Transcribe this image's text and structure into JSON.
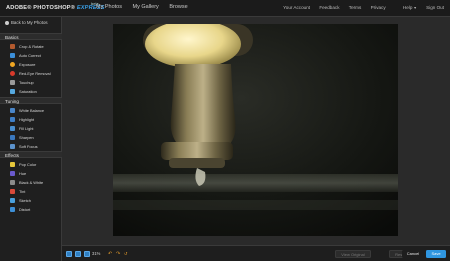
{
  "app": {
    "brand": "ADOBE® PHOTOSHOP®",
    "brand_suffix": "EXPRESS",
    "beta": "beta"
  },
  "topnav": [
    "My Photos",
    "My Gallery",
    "Browse"
  ],
  "toplinks": [
    "Your Account",
    "Feedback",
    "Terms",
    "Privacy",
    "Help",
    "Sign Out"
  ],
  "sidebar": {
    "back_label": "Back to My Photos",
    "sections": [
      {
        "title": "Basics",
        "items": [
          {
            "label": "Crop & Rotate",
            "icon": "crop-icon",
            "color": "#b35a2e"
          },
          {
            "label": "Auto Correct",
            "icon": "auto-correct-icon",
            "color": "#3b8fd9"
          },
          {
            "label": "Exposure",
            "icon": "exposure-icon",
            "color": "#f0a623"
          },
          {
            "label": "Red-Eye Removal",
            "icon": "red-eye-icon",
            "color": "#d93a2b"
          },
          {
            "label": "Touchup",
            "icon": "touchup-icon",
            "color": "#9a9a9a"
          },
          {
            "label": "Saturation",
            "icon": "saturation-icon",
            "color": "#56a9e0"
          }
        ]
      },
      {
        "title": "Tuning",
        "items": [
          {
            "label": "White Balance",
            "icon": "white-balance-icon",
            "color": "#4a86c9"
          },
          {
            "label": "Highlight",
            "icon": "highlight-icon",
            "color": "#3f7fc7"
          },
          {
            "label": "Fill Light",
            "icon": "fill-light-icon",
            "color": "#4a8fd0"
          },
          {
            "label": "Sharpen",
            "icon": "sharpen-icon",
            "color": "#3a78bf"
          },
          {
            "label": "Soft Focus",
            "icon": "soft-focus-icon",
            "color": "#5b92cc"
          }
        ]
      },
      {
        "title": "Effects",
        "items": [
          {
            "label": "Pop Color",
            "icon": "pop-color-icon",
            "color": "#e6c73b"
          },
          {
            "label": "Hue",
            "icon": "hue-icon",
            "color": "#6a5acd"
          },
          {
            "label": "Black & White",
            "icon": "black-white-icon",
            "color": "#8b8b8b"
          },
          {
            "label": "Tint",
            "icon": "tint-icon",
            "color": "#d94a3a"
          },
          {
            "label": "Sketch",
            "icon": "sketch-icon",
            "color": "#4aa0dd"
          },
          {
            "label": "Distort",
            "icon": "distort-icon",
            "color": "#3d8fd6"
          }
        ]
      }
    ]
  },
  "toolbar": {
    "zoom": "31%",
    "view_original": "View Original",
    "reset_all": "Reset All",
    "cancel": "Cancel",
    "save": "Save"
  },
  "colors": {
    "accent": "#2f96e0",
    "background": "#2b2b2b",
    "sidebar": "#1f1f1f",
    "undo": "#e39b2b"
  }
}
